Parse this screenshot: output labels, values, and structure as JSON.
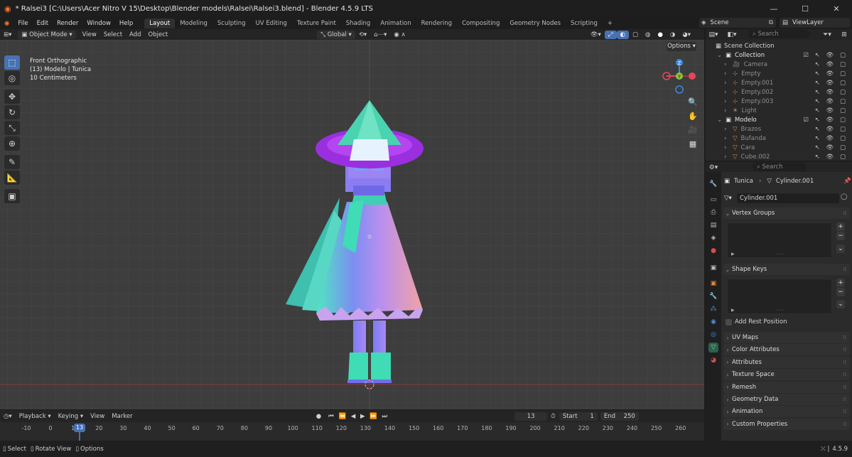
{
  "window": {
    "title": "* Ralsei3 [C:\\Users\\Acer Nitro V 15\\Desktop\\Blender models\\Ralsei\\Ralsei3.blend] - Blender 4.5.9 LTS"
  },
  "menu": [
    "File",
    "Edit",
    "Render",
    "Window",
    "Help"
  ],
  "workspaces": [
    "Layout",
    "Modeling",
    "Sculpting",
    "UV Editing",
    "Texture Paint",
    "Shading",
    "Animation",
    "Rendering",
    "Compositing",
    "Geometry Nodes",
    "Scripting"
  ],
  "active_workspace": "Layout",
  "scene": {
    "name": "Scene",
    "view_layer": "ViewLayer"
  },
  "viewport_header": {
    "mode": "Object Mode",
    "menus": [
      "View",
      "Select",
      "Add",
      "Object"
    ],
    "orientation": "Global"
  },
  "viewport": {
    "view_name": "Front Orthographic",
    "object_info": "(13) Modelo | Tunica",
    "scale": "10 Centimeters",
    "options": "Options",
    "gizmo": {
      "z": "Z",
      "y": "Y"
    }
  },
  "outliner": {
    "search_placeholder": "Search",
    "root": "Scene Collection",
    "rows": [
      {
        "label": "Collection",
        "level": 1,
        "kind": "collection"
      },
      {
        "label": "Camera",
        "level": 2,
        "kind": "camera"
      },
      {
        "label": "Empty",
        "level": 2,
        "kind": "empty"
      },
      {
        "label": "Empty.001",
        "level": 2,
        "kind": "empty"
      },
      {
        "label": "Empty.002",
        "level": 2,
        "kind": "empty"
      },
      {
        "label": "Empty.003",
        "level": 2,
        "kind": "empty"
      },
      {
        "label": "Light",
        "level": 2,
        "kind": "light"
      },
      {
        "label": "Modelo",
        "level": 1,
        "kind": "collection"
      },
      {
        "label": "Brazos",
        "level": 2,
        "kind": "mesh"
      },
      {
        "label": "Bufanda",
        "level": 2,
        "kind": "mesh"
      },
      {
        "label": "Cara",
        "level": 2,
        "kind": "mesh"
      },
      {
        "label": "Cube.002",
        "level": 2,
        "kind": "mesh"
      }
    ]
  },
  "properties": {
    "search_placeholder": "Search",
    "object_name": "Tunica",
    "mesh_name": "Cylinder.001",
    "datablock": "Cylinder.001",
    "panels": {
      "vertex_groups": "Vertex Groups",
      "shape_keys": "Shape Keys",
      "add_rest_position": "Add Rest Position",
      "collapsed": [
        "UV Maps",
        "Color Attributes",
        "Attributes",
        "Texture Space",
        "Remesh",
        "Geometry Data",
        "Animation",
        "Custom Properties"
      ]
    }
  },
  "timeline": {
    "menus": [
      "Playback",
      "Keying",
      "View",
      "Marker"
    ],
    "current_frame": "13",
    "start_label": "Start",
    "start": "1",
    "end_label": "End",
    "end": "250",
    "ticks": [
      "-10",
      "0",
      "10",
      "20",
      "30",
      "40",
      "50",
      "60",
      "70",
      "80",
      "90",
      "100",
      "110",
      "120",
      "130",
      "140",
      "150",
      "160",
      "170",
      "180",
      "190",
      "200",
      "210",
      "220",
      "230",
      "240",
      "250",
      "260"
    ]
  },
  "status": {
    "select": "Select",
    "rotate": "Rotate View",
    "options": "Options",
    "version": "4.5.9"
  },
  "colors": {
    "accent": "#4772b3",
    "timeline_marker": "#4772b3",
    "gizmo_x": "#e8455a",
    "gizmo_y": "#8cc43c",
    "gizmo_z": "#3b8ad9"
  }
}
